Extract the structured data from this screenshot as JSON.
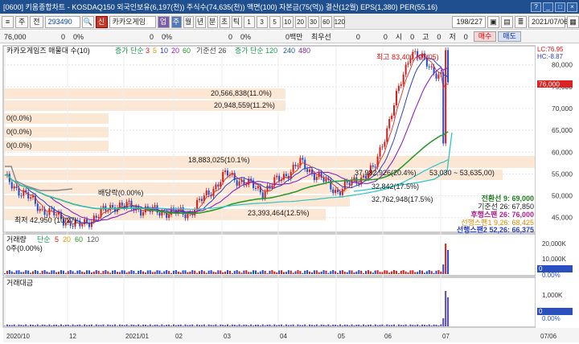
{
  "window": {
    "title": "[0600] 키움종합차트 - KOSDAQ150 외국인보유(6,197(천)) 주식수(74,635(천)) 액면(100) 자본금(75(억)) 결산(12월) EPS(1,380) PER(55.16)",
    "help_label": "?",
    "min_label": "_",
    "max_label": "□",
    "close_label": "×"
  },
  "toolbar": {
    "menu_label": "≡",
    "type_label": "주",
    "field_label": "전",
    "code_value": "293490",
    "search_icon": "search-icon",
    "badge": "신",
    "stock_name": "카카오게임",
    "tag": "업",
    "periods": [
      "주",
      "월",
      "년",
      "분",
      "초",
      "틱"
    ],
    "numbers": [
      "1",
      "3",
      "5",
      "10",
      "20",
      "30",
      "60",
      "120"
    ],
    "counter": "198/227",
    "date": "2021/07/06"
  },
  "quote": {
    "price": "76,000",
    "change": "0",
    "change_pct": "0%",
    "v1": "0",
    "v1_pct": "0%",
    "v2": "0",
    "v2_pct": "0%",
    "unit": "0백만",
    "pref_label": "최우선",
    "v3": "0",
    "v4": "0",
    "si_label": "시",
    "si_val": "0",
    "go_label": "고",
    "go_val": "0",
    "je_label": "저",
    "je_val": "0",
    "buy_label": "매수",
    "sell_label": "매도"
  },
  "chart": {
    "stock_label": "카카오게임즈 매물대 수(10)",
    "ma_label": "증가 단순",
    "ma_periods": [
      "3",
      "5",
      "10",
      "20",
      "60"
    ],
    "baseline_label": "기준선 26",
    "ma2_label": "증가 단순 120",
    "ma2_periods": [
      "240",
      "480"
    ],
    "lc_label": "LC:76.95",
    "hc_label": "HC:-8.87",
    "high_label": "최고 83,400 (07/05)",
    "low_label": "최저 42,950 (10/27)",
    "dividend_label": "배당락(0.00%)",
    "vp_labels": [
      "20,566,838(11.0%)",
      "20,948,559(11.2%)",
      "0(0.0%)",
      "0(0.0%)",
      "0(0.0%)",
      "18,883,025(10.1%)",
      "37,982,926(20.4%)",
      "32,842(17.5%)",
      "32,762,948(17.5%)",
      "23,393,464(12.5%)"
    ],
    "range_label": "53,030 ~ 53,635,00)",
    "indicators": [
      {
        "label": "전환선 9: 69,000",
        "color": "#1c7a1c"
      },
      {
        "label": "기준선 26: 67,850",
        "color": "#1d1d1d"
      },
      {
        "label": "후행스팬 26: 76,000",
        "color": "#b02090"
      },
      {
        "label": "선행스팬1 9,26: 68,425",
        "color": "#e08a00"
      },
      {
        "label": "선행스팬2 52,26: 66,375",
        "color": "#2a40c0"
      }
    ],
    "price_ticks": [
      "80,000",
      "75,000",
      "70,000",
      "65,000",
      "60,000",
      "55,000",
      "50,000",
      "45,000"
    ],
    "current_price": "76,000",
    "volume_label": "거래량",
    "volume_ma_label": "단순",
    "volume_ma_periods": [
      "5",
      "20",
      "60",
      "120"
    ],
    "volume_value": "0주(0.00%)",
    "volume_ticks": [
      "20,000K",
      "10,000K",
      "0"
    ],
    "volume_pct": "0.00%",
    "amount_label": "거래대금",
    "amount_ticks": [
      "1,000K",
      "0"
    ],
    "amount_pct": "0.00%",
    "x_labels": [
      "2020/10",
      "12",
      "2021/01",
      "02",
      "03",
      "04",
      "05",
      "06",
      "07"
    ],
    "x_right": "07/06"
  },
  "chart_data": {
    "type": "line",
    "x_start": "2020/09",
    "x_end": "2021/07/06",
    "ylim": [
      42000,
      84000
    ],
    "close_series": [
      {
        "date": "2020/09",
        "close": 54000
      },
      {
        "date": "2020/10",
        "close": 47000
      },
      {
        "date": "2020/10/27",
        "close": 42950
      },
      {
        "date": "2020/11",
        "close": 48000
      },
      {
        "date": "2020/12",
        "close": 46500
      },
      {
        "date": "2021/01",
        "close": 46000
      },
      {
        "date": "2021/02",
        "close": 55000
      },
      {
        "date": "2021/03",
        "close": 51000
      },
      {
        "date": "2021/04",
        "close": 57500
      },
      {
        "date": "2021/05",
        "close": 51000
      },
      {
        "date": "2021/06",
        "close": 56000
      },
      {
        "date": "2021/07/05",
        "close": 83400
      },
      {
        "date": "2021/07/06",
        "close": 76000
      }
    ],
    "volume_max": 20000000
  }
}
